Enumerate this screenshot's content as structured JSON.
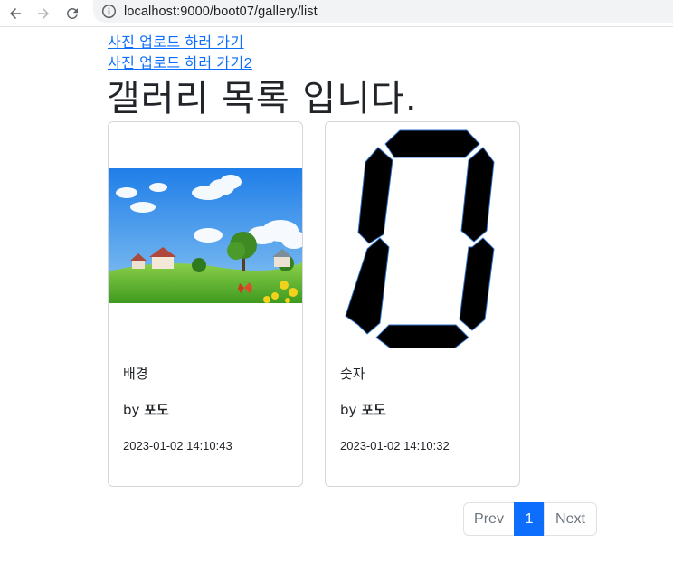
{
  "browser": {
    "url": "localhost:9000/boot07/gallery/list"
  },
  "links": {
    "upload": "사진 업로드 하러 가기",
    "upload2": "사진 업로드 하러 가기2"
  },
  "page_title": "갤러리 목록 입니다.",
  "cards": [
    {
      "title": "배경",
      "by_label": "by",
      "author": "포도",
      "date": "2023-01-02 14:10:43"
    },
    {
      "title": "숫자",
      "by_label": "by",
      "author": "포도",
      "date": "2023-01-02 14:10:32"
    }
  ],
  "pagination": {
    "prev": "Prev",
    "current": "1",
    "next": "Next"
  },
  "colors": {
    "link": "#0d6efd",
    "active_page": "#0d6efd"
  }
}
